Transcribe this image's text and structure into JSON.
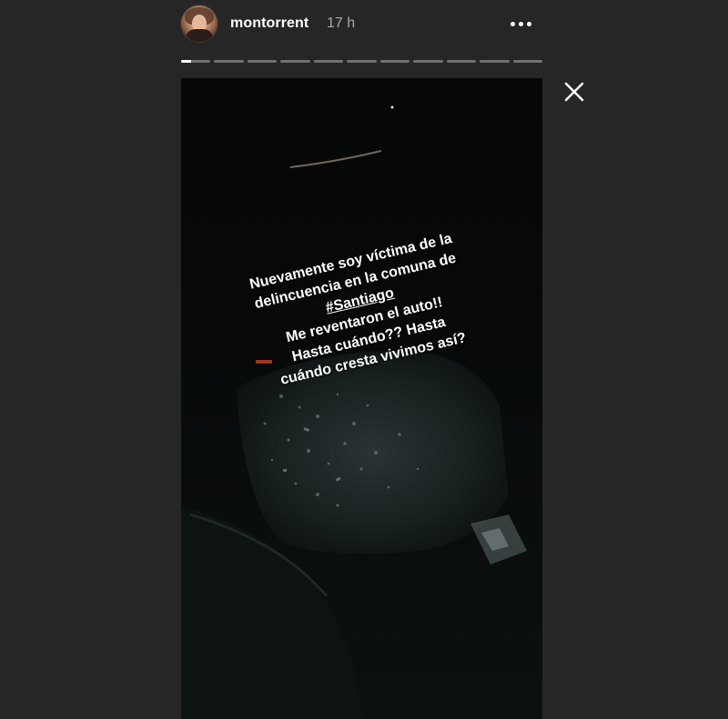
{
  "header": {
    "username": "montorrent",
    "timestamp": "17 h",
    "avatar_icon": "profile-avatar-icon",
    "more_icon": "more-options-icon"
  },
  "progress": {
    "total_segments": 11,
    "current_segment": 1,
    "current_fraction": 0.35,
    "fill_color": "#ffffff",
    "track_color": "rgba(255,255,255,0.35)"
  },
  "close_icon": "close-icon",
  "story": {
    "caption_lines": [
      "Nuevamente soy víctima de la",
      "delincuencia en la comuna de",
      "#Santiago",
      "Me reventaron el auto!!",
      "Hasta cuándo?? Hasta",
      "cuándo cresta vivimos así?"
    ]
  },
  "colors": {
    "background": "#262626",
    "text": "#ffffff",
    "muted_text": "#a8a8a8"
  }
}
